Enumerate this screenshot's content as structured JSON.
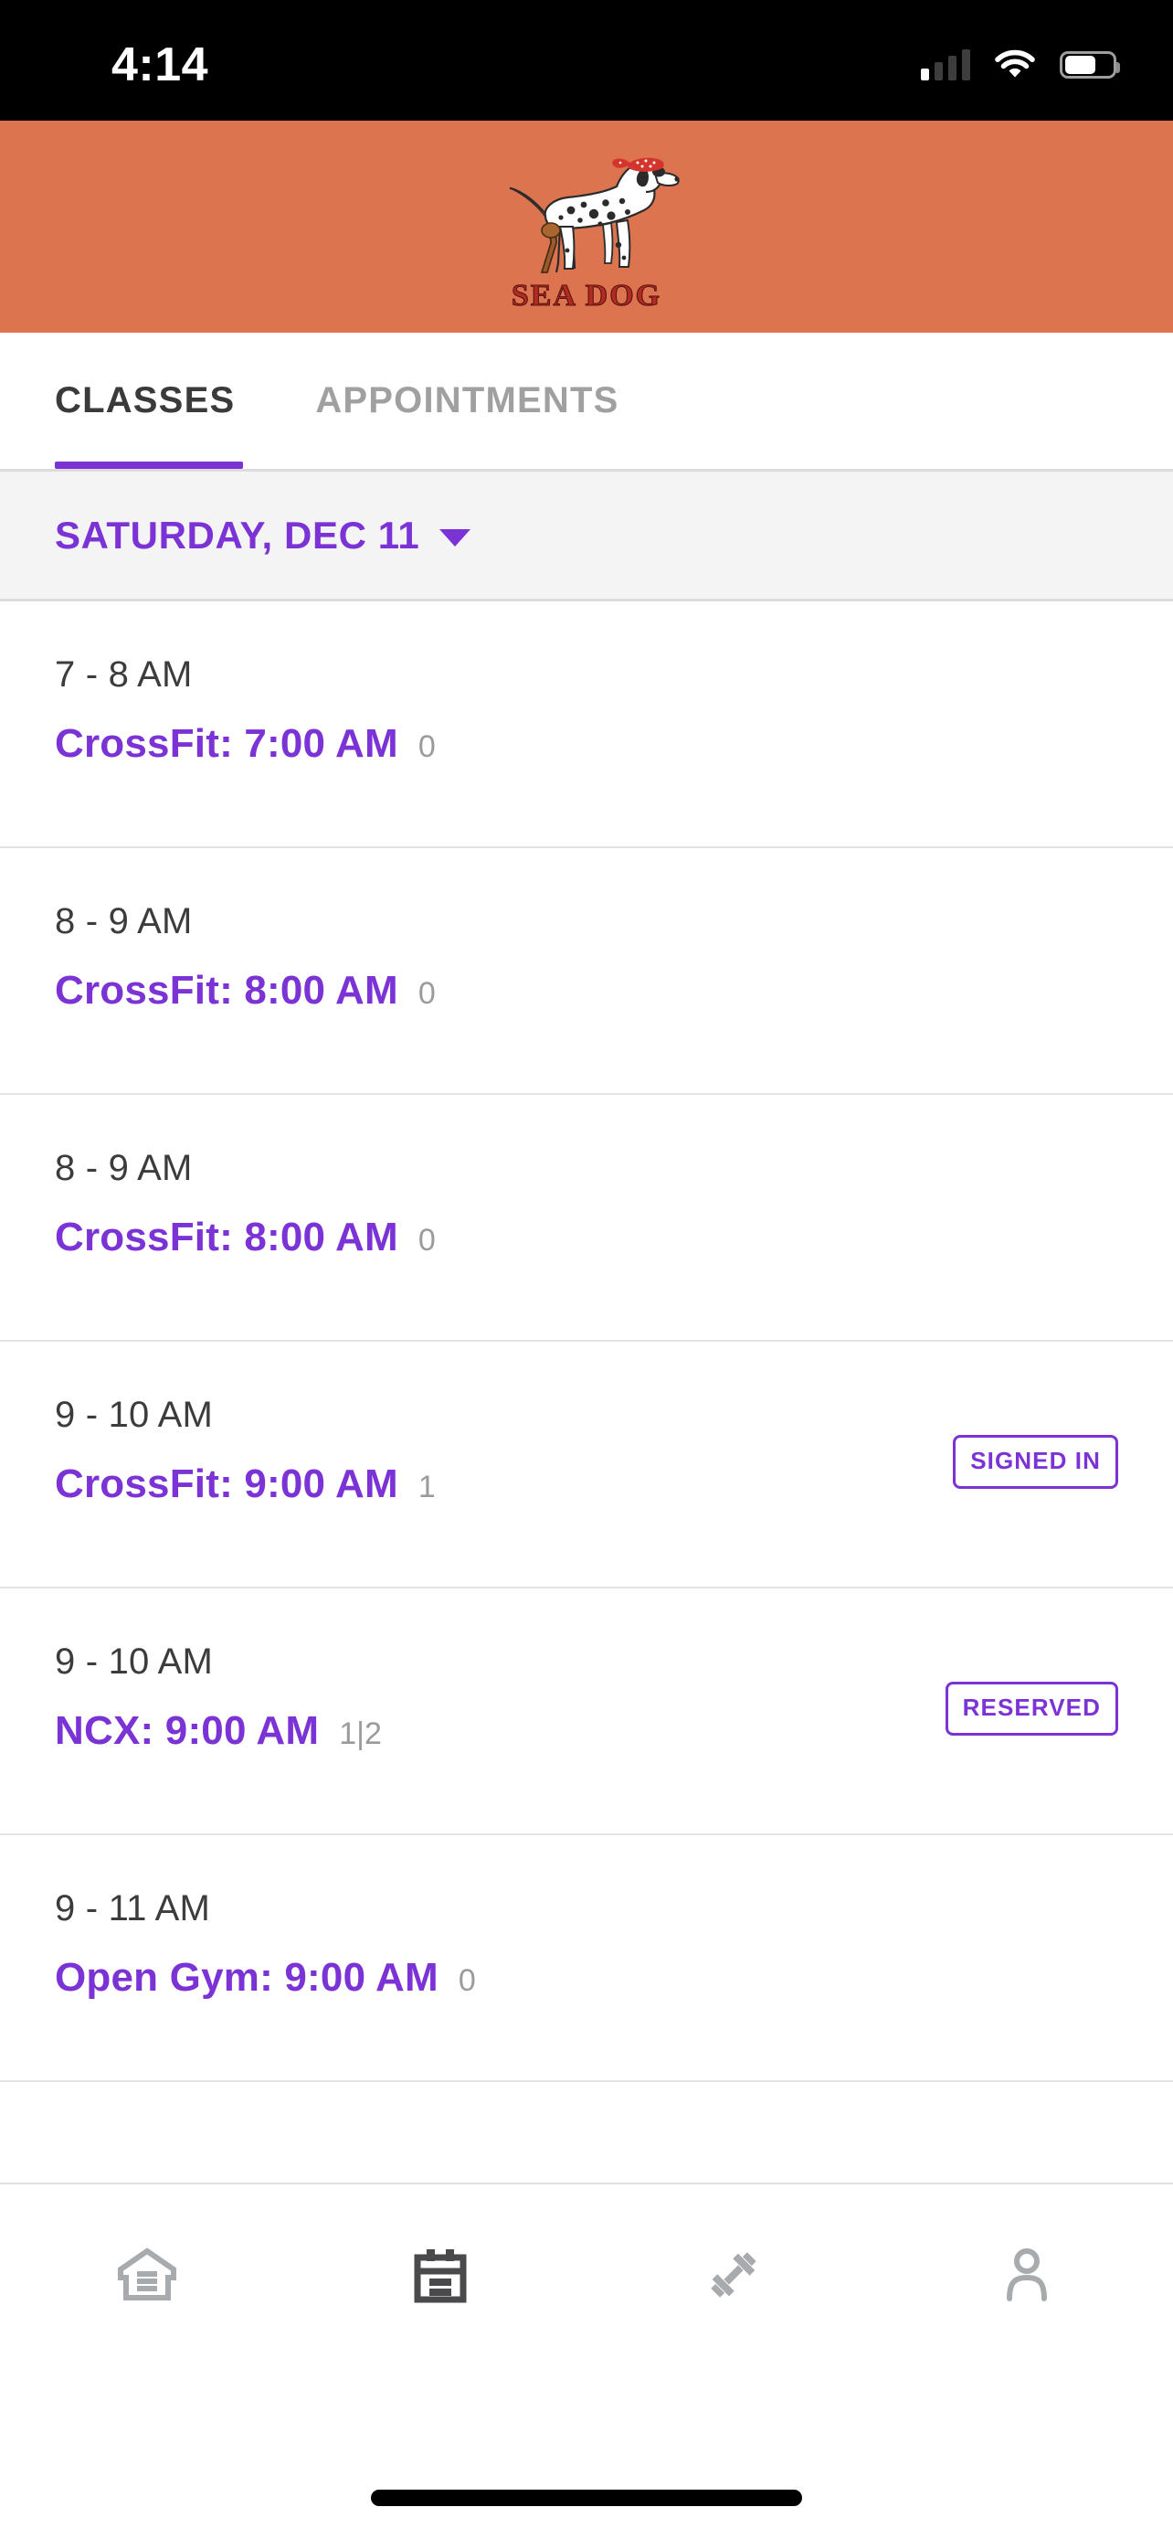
{
  "status_bar": {
    "time": "4:14",
    "signal_icon": "cellular-signal-icon",
    "signal_bars_filled": 1,
    "signal_bars_total": 4,
    "wifi_icon": "wifi-icon",
    "battery_icon": "battery-icon",
    "battery_level_percent": 55
  },
  "brand_header": {
    "logo_name": "sea-dog-logo",
    "logo_text": "SEA DOG",
    "background_color": "#dd7450",
    "logo_text_color": "#b02b22"
  },
  "tabs": {
    "active_index": 0,
    "items": [
      {
        "label": "CLASSES",
        "active": true
      },
      {
        "label": "APPOINTMENTS",
        "active": false
      }
    ],
    "underline_color": "#7b33d6"
  },
  "date_selector": {
    "label": "SATURDAY, DEC 11",
    "caret_icon": "chevron-down-icon",
    "color": "#7b33d6"
  },
  "classes": [
    {
      "time_range": "7 - 8 AM",
      "name": "CrossFit: 7:00 AM",
      "count": "0",
      "badge": null
    },
    {
      "time_range": "8 - 9 AM",
      "name": "CrossFit: 8:00 AM",
      "count": "0",
      "badge": null
    },
    {
      "time_range": "8 - 9 AM",
      "name": "CrossFit: 8:00 AM",
      "count": "0",
      "badge": null
    },
    {
      "time_range": "9 - 10 AM",
      "name": "CrossFit: 9:00 AM",
      "count": "1",
      "badge": "SIGNED IN"
    },
    {
      "time_range": "9 - 10 AM",
      "name": "NCX: 9:00 AM",
      "count": "1|2",
      "badge": "RESERVED"
    },
    {
      "time_range": "9 - 11 AM",
      "name": "Open Gym: 9:00 AM",
      "count": "0",
      "badge": null
    }
  ],
  "bottom_nav": {
    "active_index": 1,
    "items": [
      {
        "icon": "home-building-icon",
        "active": false
      },
      {
        "icon": "calendar-icon",
        "active": true
      },
      {
        "icon": "dumbbell-icon",
        "active": false
      },
      {
        "icon": "person-icon",
        "active": false
      }
    ],
    "active_color": "#4a4a4d",
    "inactive_color": "#a7abad"
  },
  "home_indicator": {
    "name": "home-indicator"
  },
  "colors": {
    "accent_purple": "#7b33d6",
    "brand_orange": "#dd7450",
    "text_dark": "#3c3c3c",
    "text_muted": "#9b9b9b",
    "divider": "#e3e3e3"
  }
}
